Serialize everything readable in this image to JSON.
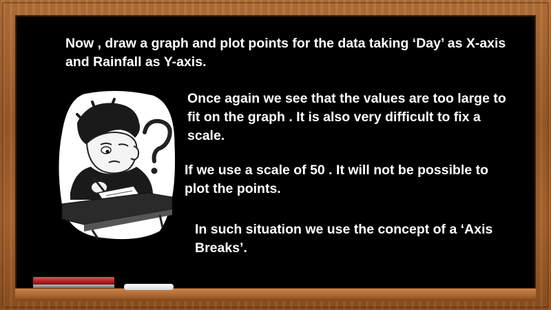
{
  "slide": {
    "paragraph_1": "Now , draw a graph and plot points for the data taking ‘Day’ as X-axis and Rainfall as Y-axis.",
    "paragraph_2": "Once again we see that the values are too large to fit on the graph . It is also very difficult to fix a scale.",
    "paragraph_3": "If we use a scale of 50 . It will not be possible to plot the points.",
    "paragraph_4": "In such situation we use the concept of a ‘Axis Breaks’.",
    "illustration_icon": "confused-student-icon",
    "colors": {
      "board": "#000000",
      "frame": "#a8652f",
      "text": "#ffffff",
      "red_chalk": "#c62828",
      "white_chalk": "#f2f2f2"
    }
  }
}
